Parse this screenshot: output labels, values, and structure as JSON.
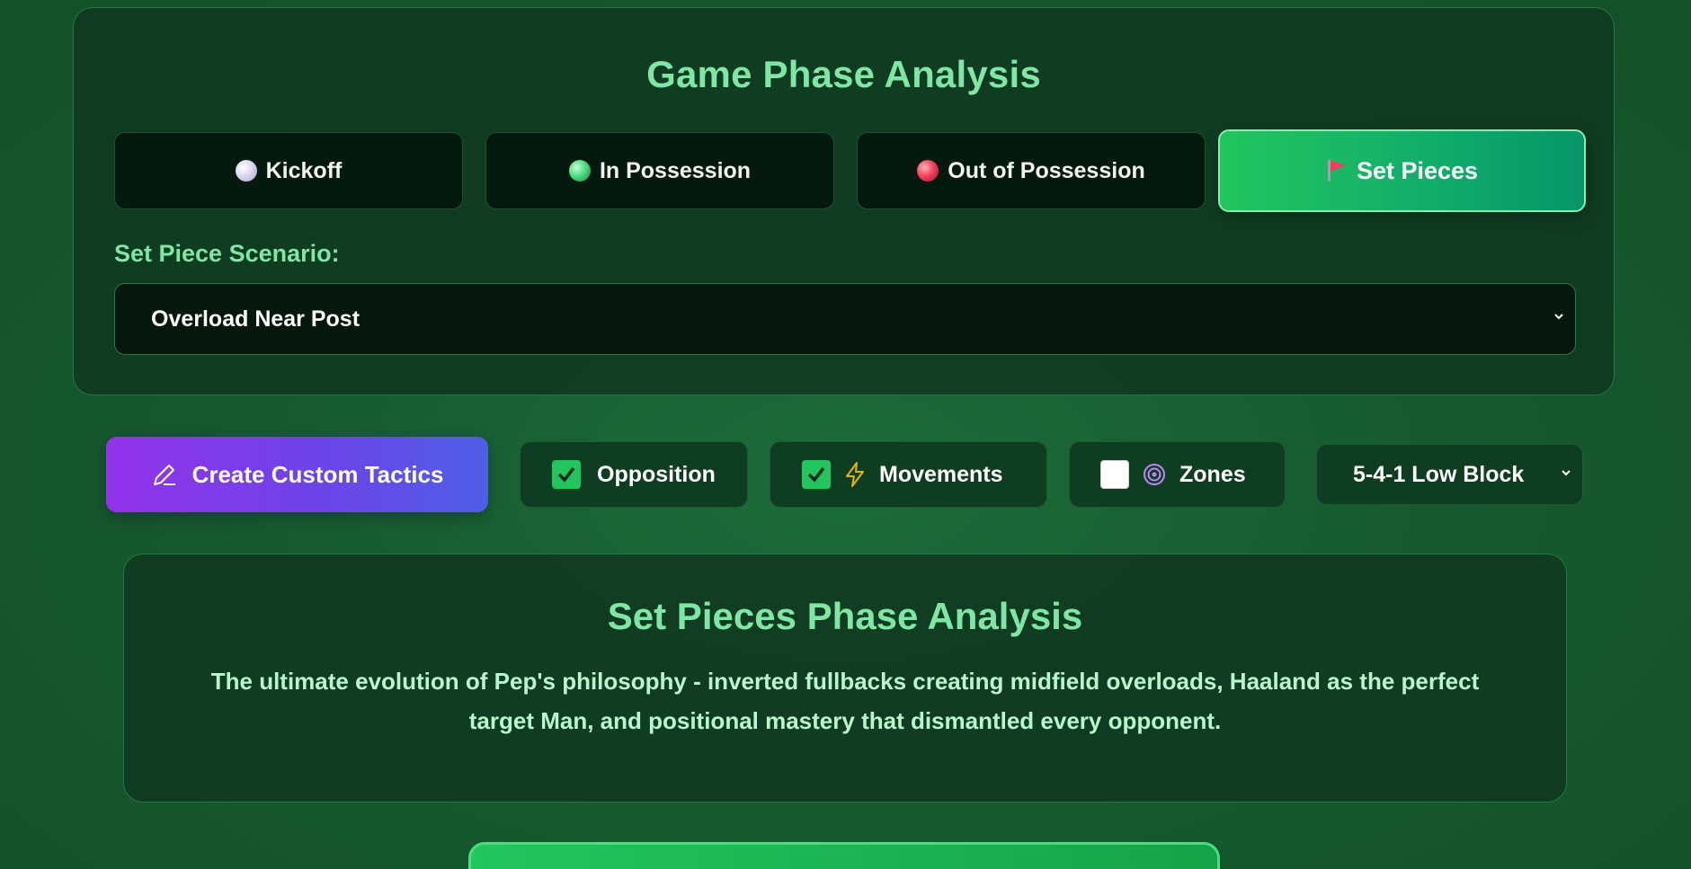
{
  "phase_panel": {
    "title": "Game Phase Analysis",
    "tabs": [
      {
        "label": "Kickoff",
        "icon": "white-ball-icon",
        "active": false
      },
      {
        "label": "In Possession",
        "icon": "green-ball-icon",
        "active": false
      },
      {
        "label": "Out of Possession",
        "icon": "red-ball-icon",
        "active": false
      },
      {
        "label": "Set Pieces",
        "icon": "flag-icon",
        "active": true
      }
    ],
    "scenario_label": "Set Piece Scenario:",
    "scenario_value": "Overload Near Post"
  },
  "controls": {
    "create_label": "Create Custom Tactics",
    "opposition": {
      "label": "Opposition",
      "checked": true
    },
    "movements": {
      "label": "Movements",
      "checked": true
    },
    "zones": {
      "label": "Zones",
      "checked": false
    },
    "formation": "5-4-1 Low Block"
  },
  "analysis": {
    "title": "Set Pieces Phase Analysis",
    "text": "The ultimate evolution of Pep's philosophy - inverted fullbacks creating midfield overloads, Haaland as the perfect target Man, and positional mastery that dismantled every opponent."
  },
  "colors": {
    "accent": "#22c55e",
    "heading": "#7ee7a3",
    "purple": "#9333ea"
  }
}
